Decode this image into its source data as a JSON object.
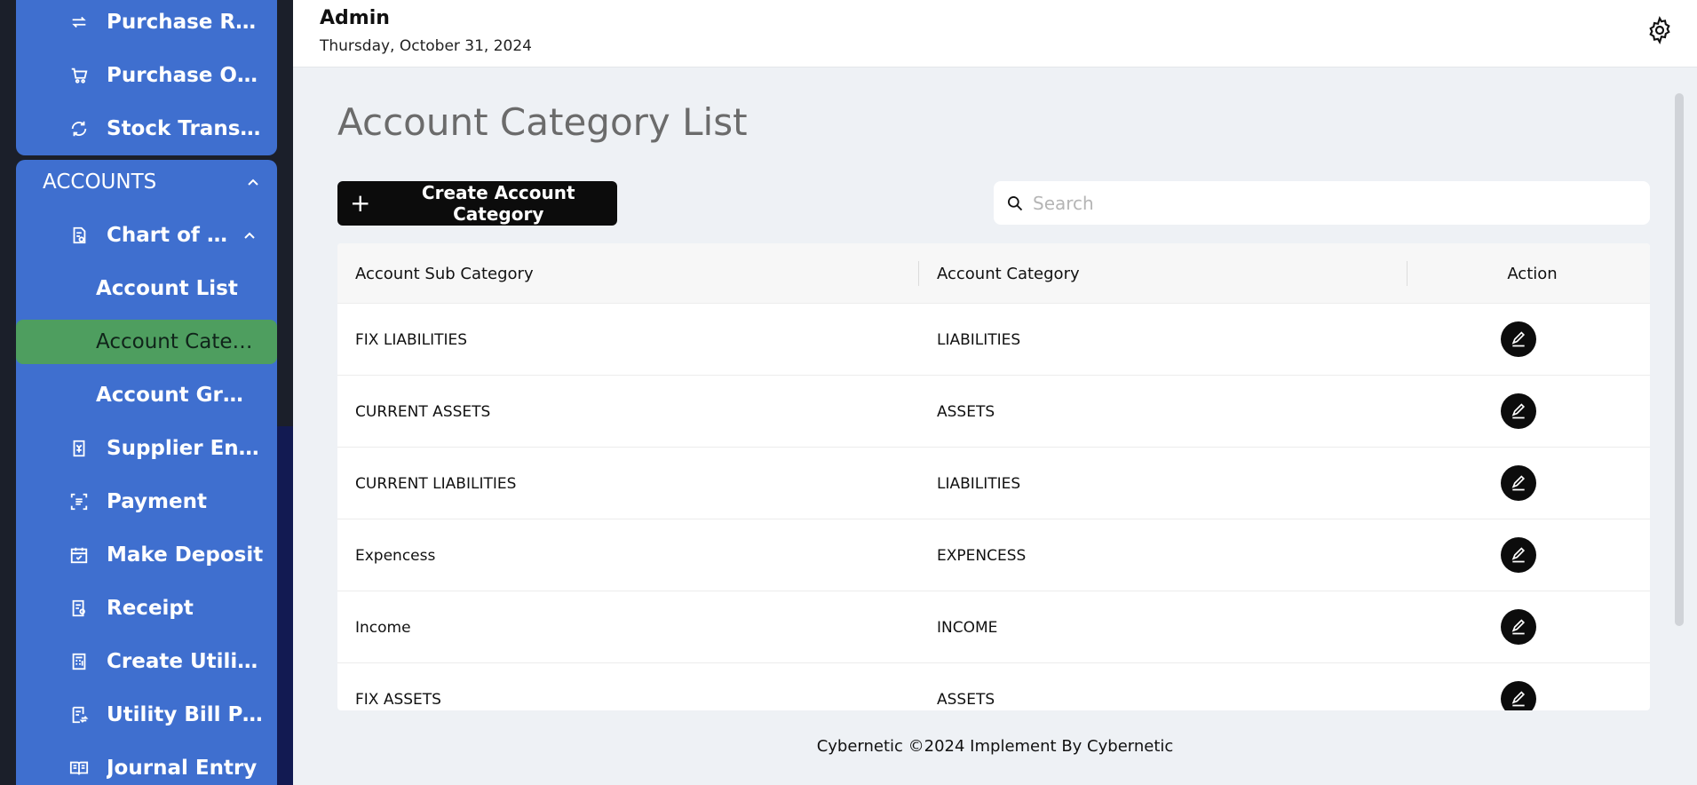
{
  "sidebar": {
    "top_items": [
      {
        "label": "Purchase Retu...",
        "icon": "return-arrows-icon"
      },
      {
        "label": "Purchase Order",
        "icon": "cart-icon"
      },
      {
        "label": "Stock Transfer",
        "icon": "refresh-icon"
      }
    ],
    "section": {
      "label": "ACCOUNTS",
      "icon": "chevron-up-icon"
    },
    "chart_of_accounts": {
      "label": "Chart of Acc...",
      "icon": "document-check-icon"
    },
    "sub_items": [
      {
        "label": "Account List"
      },
      {
        "label": "Account Cater..."
      },
      {
        "label": "Account Group"
      }
    ],
    "items": [
      {
        "label": "Supplier Enter ...",
        "icon": "receipt-icon"
      },
      {
        "label": "Payment",
        "icon": "list-scan-icon"
      },
      {
        "label": "Make Deposit",
        "icon": "calendar-check-icon"
      },
      {
        "label": "Receipt",
        "icon": "receipt-user-icon"
      },
      {
        "label": "Create Utility ...",
        "icon": "calculator-icon"
      },
      {
        "label": "Utility Bill Pay...",
        "icon": "bill-pay-icon"
      },
      {
        "label": "Journal Entry",
        "icon": "book-icon"
      }
    ]
  },
  "header": {
    "user": "Admin",
    "date": "Thursday, October 31, 2024",
    "settings_icon": "gear-icon"
  },
  "main": {
    "title": "Account Category List",
    "create_button": "Create Account Category",
    "search_placeholder": "Search",
    "table": {
      "columns": [
        "Account Sub Category",
        "Account Category",
        "Action"
      ],
      "rows": [
        {
          "sub": "FIX LIABILITIES",
          "cat": "LIABILITIES"
        },
        {
          "sub": "CURRENT ASSETS",
          "cat": "ASSETS"
        },
        {
          "sub": "CURRENT LIABILITIES",
          "cat": "LIABILITIES"
        },
        {
          "sub": "Expencess",
          "cat": "EXPENCESS"
        },
        {
          "sub": "Income",
          "cat": "INCOME"
        },
        {
          "sub": "FIX ASSETS",
          "cat": "ASSETS"
        }
      ]
    }
  },
  "footer": "Cybernetic ©2024 Implement By Cybernetic",
  "colors": {
    "sidebar_blue": "#3f6fcf",
    "active_green": "#4e9e5f",
    "primary_black": "#0c0c0c"
  }
}
